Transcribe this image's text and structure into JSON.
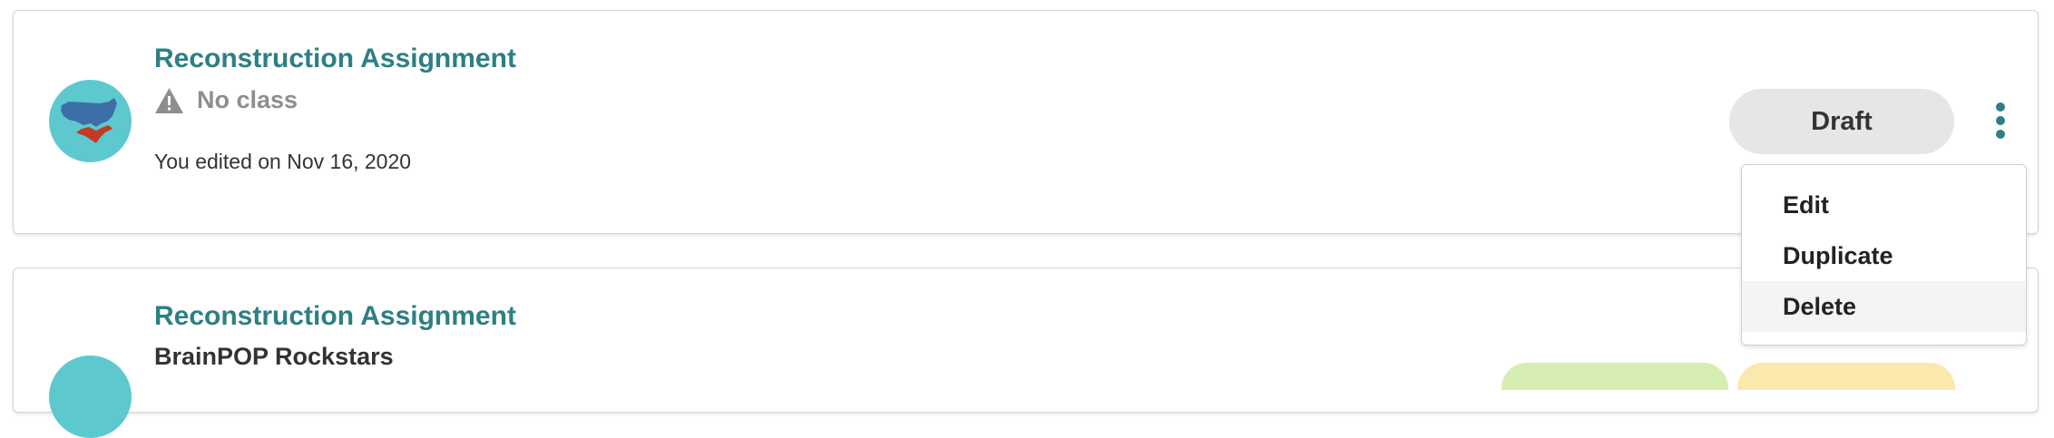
{
  "assignments": [
    {
      "title": "Reconstruction Assignment",
      "class_name": "No class",
      "edited": "You edited on Nov 16, 2020",
      "status": "Draft"
    },
    {
      "title": "Reconstruction Assignment",
      "class_name": "BrainPOP Rockstars"
    }
  ],
  "menu": {
    "items": [
      "Edit",
      "Duplicate",
      "Delete"
    ],
    "highlighted": "Delete"
  },
  "colors": {
    "title": "#2d7f83",
    "avatar_bg": "#5dc9cf",
    "muted_text": "#8e8e8e",
    "draft_pill": "#e6e6e6",
    "status_green": "#d6edb2",
    "status_yellow": "#fbe8ad"
  },
  "icons": {
    "avatar": "us-map-icon",
    "no_class": "warning-icon",
    "more": "more-vertical-icon"
  }
}
